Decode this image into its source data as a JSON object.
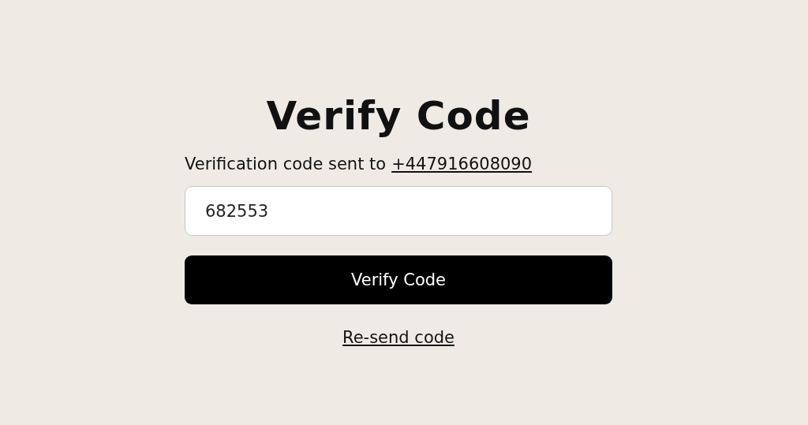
{
  "title": "Verify Code",
  "message": {
    "text": "Verification code sent to",
    "phone": "+447916608090"
  },
  "code_field": {
    "value": "682553"
  },
  "verify_button": {
    "label": "Verify Code"
  },
  "resend_link": {
    "label": "Re-send code"
  }
}
